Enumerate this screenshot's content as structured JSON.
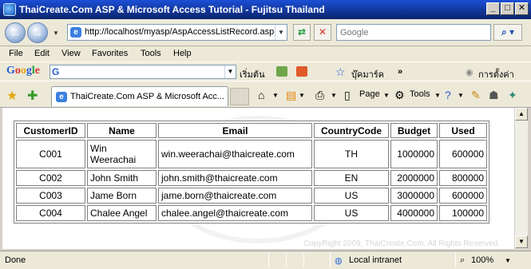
{
  "window": {
    "title": "ThaiCreate.Com ASP & Microsoft Access Tutorial - Fujitsu Thailand"
  },
  "address": {
    "url": "http://localhost/myasp/AspAccessListRecord.asp",
    "search_placeholder": "Google"
  },
  "menu": [
    "File",
    "Edit",
    "View",
    "Favorites",
    "Tools",
    "Help"
  ],
  "google_toolbar": {
    "start_label": "เริ่มต้น",
    "bookmarks_label": "บุ๊คมาร์ค",
    "more_label": "»",
    "settings_label": "การตั้งค่า"
  },
  "tab": {
    "label": "ThaiCreate.Com ASP & Microsoft Acc..."
  },
  "commands": {
    "page_label": "Page",
    "tools_label": "Tools"
  },
  "table": {
    "headers": [
      "CustomerID",
      "Name",
      "Email",
      "CountryCode",
      "Budget",
      "Used"
    ],
    "rows": [
      [
        "C001",
        "Win Weerachai",
        "win.weerachai@thaicreate.com",
        "TH",
        "1000000",
        "600000"
      ],
      [
        "C002",
        "John Smith",
        "john.smith@thaicreate.com",
        "EN",
        "2000000",
        "800000"
      ],
      [
        "C003",
        "Jame Born",
        "jame.born@thaicreate.com",
        "US",
        "3000000",
        "600000"
      ],
      [
        "C004",
        "Chalee Angel",
        "chalee.angel@thaicreate.com",
        "US",
        "4000000",
        "100000"
      ]
    ]
  },
  "page": {
    "copyright": "CopyRight 2009, ThaiCreate.Com. All Rights Reserved."
  },
  "status": {
    "text": "Done",
    "zone": "Local intranet",
    "zoom": "100%"
  }
}
